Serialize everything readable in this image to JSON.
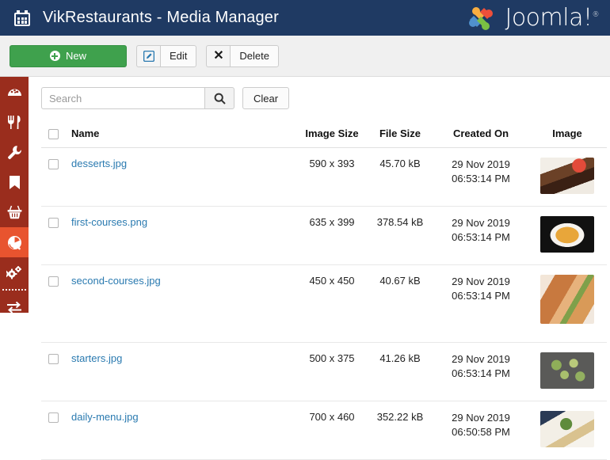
{
  "header": {
    "icon": "calendar-icon",
    "title": "VikRestaurants - Media Manager",
    "brand": "Joomla!",
    "brand_trademark": "®",
    "bg_color": "#1f3a63"
  },
  "toolbar": {
    "new_label": "New",
    "new_icon": "plus-circle-icon",
    "new_color": "#3fa14d",
    "edit_label": "Edit",
    "edit_icon": "pencil-square-icon",
    "delete_label": "Delete",
    "delete_icon": "x-icon"
  },
  "sidebar": {
    "bg_color": "#9a2d1d",
    "active_color": "#e8542f",
    "items": [
      {
        "icon": "dashboard-icon",
        "active": false
      },
      {
        "icon": "cutlery-icon",
        "active": false
      },
      {
        "icon": "wrench-icon",
        "active": false
      },
      {
        "icon": "bookmark-icon",
        "active": false
      },
      {
        "icon": "basket-icon",
        "active": false
      },
      {
        "icon": "globe-icon",
        "active": true
      },
      {
        "icon": "cogs-icon",
        "active": false
      },
      {
        "icon": "exchange-icon",
        "active": false
      }
    ]
  },
  "search": {
    "value": "",
    "placeholder": "Search",
    "button_icon": "search-icon",
    "clear_label": "Clear"
  },
  "table": {
    "columns": [
      {
        "key": "check",
        "label": ""
      },
      {
        "key": "name",
        "label": "Name"
      },
      {
        "key": "image_size",
        "label": "Image Size"
      },
      {
        "key": "file_size",
        "label": "File Size"
      },
      {
        "key": "created_on",
        "label": "Created On"
      },
      {
        "key": "image",
        "label": "Image"
      }
    ],
    "rows": [
      {
        "name": "desserts.jpg",
        "image_size": "590 x 393",
        "file_size": "45.70 kB",
        "created_date": "29 Nov 2019",
        "created_time": "06:53:14 PM",
        "thumb": "th-desserts"
      },
      {
        "name": "first-courses.png",
        "image_size": "635 x 399",
        "file_size": "378.54 kB",
        "created_date": "29 Nov 2019",
        "created_time": "06:53:14 PM",
        "thumb": "th-first"
      },
      {
        "name": "second-courses.jpg",
        "image_size": "450 x 450",
        "file_size": "40.67 kB",
        "created_date": "29 Nov 2019",
        "created_time": "06:53:14 PM",
        "thumb": "th-second"
      },
      {
        "name": "starters.jpg",
        "image_size": "500 x 375",
        "file_size": "41.26 kB",
        "created_date": "29 Nov 2019",
        "created_time": "06:53:14 PM",
        "thumb": "th-starters"
      },
      {
        "name": "daily-menu.jpg",
        "image_size": "700 x 460",
        "file_size": "352.22 kB",
        "created_date": "29 Nov 2019",
        "created_time": "06:50:58 PM",
        "thumb": "th-daily"
      }
    ]
  }
}
